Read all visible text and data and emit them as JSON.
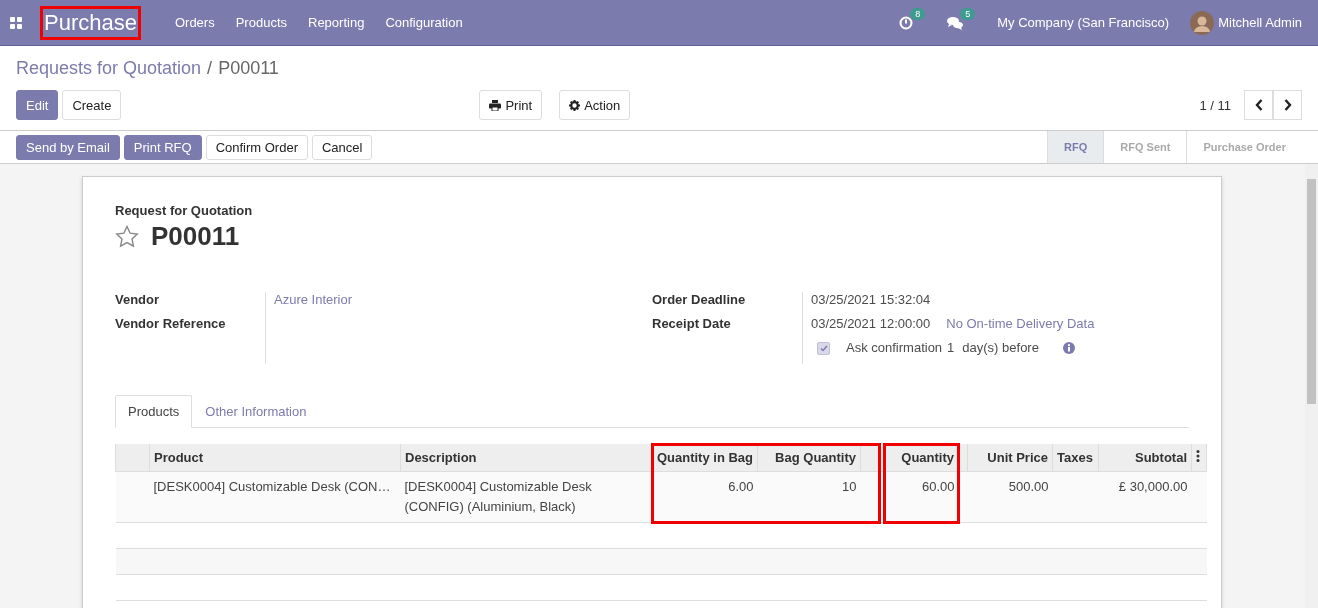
{
  "navbar": {
    "app_name": "Purchase",
    "app_name_highlighted": true,
    "menu": [
      "Orders",
      "Products",
      "Reporting",
      "Configuration"
    ],
    "activity_count": "8",
    "message_count": "5",
    "company": "My Company (San Francisco)",
    "user": "Mitchell Admin"
  },
  "breadcrumb": [
    "Requests for Quotation",
    "P00011"
  ],
  "breadcrumb_separator": "/",
  "control_buttons": [
    {
      "label": "Edit",
      "kind": "primary"
    },
    {
      "label": "Create",
      "kind": "secondary"
    }
  ],
  "sidebar_buttons": [
    {
      "label": "Print",
      "kind": "print"
    },
    {
      "label": "Action",
      "kind": "action"
    }
  ],
  "pager": "1 / 11",
  "header_buttons": [
    {
      "label": "Send by Email",
      "kind": "primary"
    },
    {
      "label": "Print RFQ",
      "kind": "primary"
    },
    {
      "label": "Confirm Order",
      "kind": "secondary"
    },
    {
      "label": "Cancel",
      "kind": "secondary"
    }
  ],
  "statusbar": [
    {
      "label": "RFQ",
      "selected": true
    },
    {
      "label": "RFQ Sent",
      "selected": false
    },
    {
      "label": "Purchase Order",
      "selected": false
    }
  ],
  "form": {
    "subtitle": "Request for Quotation",
    "name": "P00011",
    "starred": false,
    "left_fields": [
      {
        "label": "Vendor",
        "value": "Azure Interior"
      },
      {
        "label": "Vendor Reference"
      }
    ],
    "order_deadline": {
      "label": "Order Deadline",
      "value": "03/25/2021 15:32:04"
    },
    "receipt_date": {
      "label": "Receipt Date",
      "value": "03/25/2021 12:00:00",
      "note": "No On-time Delivery Data"
    },
    "ask_confirmation": {
      "checked": true,
      "label": "Ask confirmation",
      "days": "1",
      "suffix": "day(s) before"
    }
  },
  "tabs": [
    {
      "label": "Products",
      "selected": true
    },
    {
      "label": "Other Information",
      "selected": false
    }
  ],
  "table": {
    "columns": [
      {
        "kind": "handle",
        "highlighted": false
      },
      {
        "label": "Product",
        "kind": "text",
        "highlighted": false
      },
      {
        "label": "Description",
        "kind": "text",
        "highlighted": false
      },
      {
        "label": "Quantity in Bag",
        "kind": "number",
        "highlighted": true,
        "starts_box": true
      },
      {
        "label": "Bag Quantity",
        "kind": "number",
        "highlighted": true,
        "starts_box": false
      },
      {
        "kind": "spacer",
        "highlighted": true,
        "starts_box": false
      },
      {
        "label": "Quantity",
        "kind": "number",
        "highlighted": true,
        "starts_box": true
      },
      {
        "kind": "spacer",
        "highlighted": false
      },
      {
        "label": "Unit Price",
        "kind": "number",
        "highlighted": false
      },
      {
        "label": "Taxes",
        "kind": "text",
        "highlighted": false
      },
      {
        "label": "Subtotal",
        "kind": "number",
        "highlighted": false
      },
      {
        "kind": "options",
        "highlighted": false
      }
    ],
    "rows": [
      [
        null,
        "[DESK0004] Customizable Desk (CON…",
        "[DESK0004] Customizable Desk (CONFIG) (Aluminium, Black)",
        "6.00",
        "10",
        null,
        "60.00",
        null,
        "500.00",
        null,
        "£ 30,000.00",
        null
      ]
    ]
  }
}
